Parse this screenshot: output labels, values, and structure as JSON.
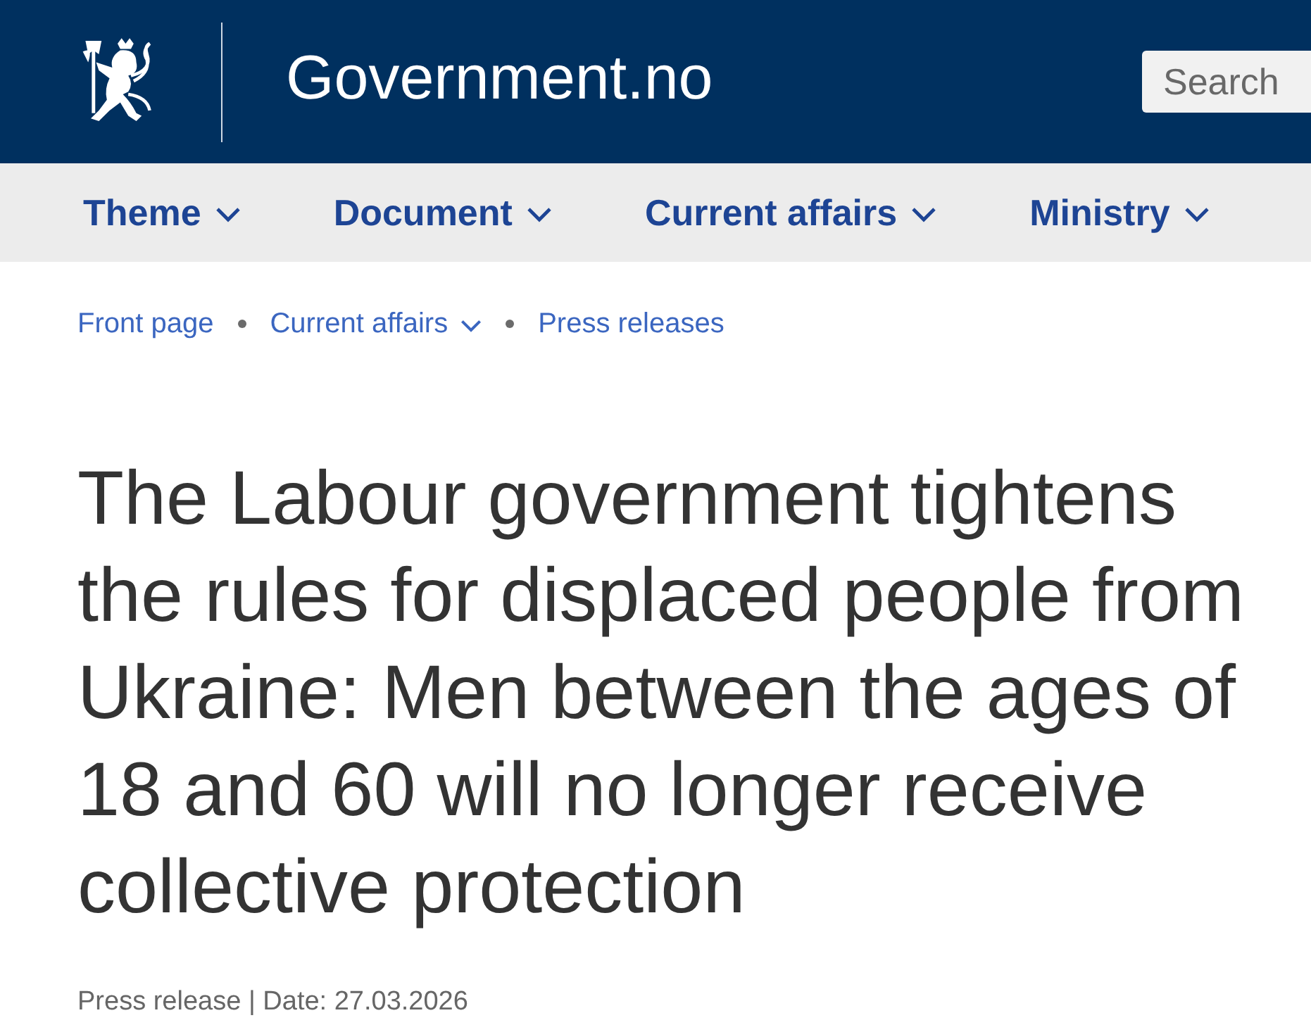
{
  "header": {
    "site_title": "Government.no",
    "search": {
      "placeholder": "Search"
    }
  },
  "nav": {
    "items": [
      {
        "label": "Theme",
        "has_dropdown": true
      },
      {
        "label": "Document",
        "has_dropdown": true
      },
      {
        "label": "Current affairs",
        "has_dropdown": true
      },
      {
        "label": "Ministry",
        "has_dropdown": true
      }
    ]
  },
  "breadcrumbs": [
    {
      "label": "Front page",
      "has_dropdown": false
    },
    {
      "label": "Current affairs",
      "has_dropdown": true
    },
    {
      "label": "Press releases",
      "has_dropdown": false
    }
  ],
  "article": {
    "title": "The Labour government tightens the rules for displaced people from Ukraine: Men between the ages of 18 and 60 will no longer receive collective protection",
    "meta": "Press release | Date: 27.03.2026"
  }
}
